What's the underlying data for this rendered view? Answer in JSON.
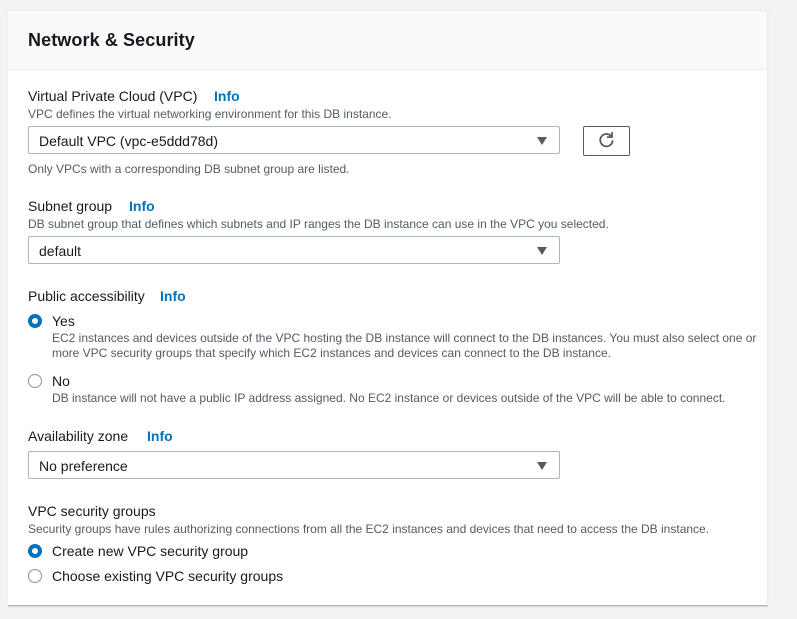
{
  "panel": {
    "title": "Network & Security"
  },
  "vpc": {
    "label": "Virtual Private Cloud (VPC)",
    "info": "Info",
    "description": "VPC defines the virtual networking environment for this DB instance.",
    "selected": "Default VPC (vpc-e5ddd78d)",
    "hint": "Only VPCs with a corresponding DB subnet group are listed.",
    "refresh_icon": "refresh-icon"
  },
  "subnet": {
    "label": "Subnet group",
    "info": "Info",
    "description": "DB subnet group that defines which subnets and IP ranges the DB instance can use in the VPC you selected.",
    "selected": "default"
  },
  "public_access": {
    "label": "Public accessibility",
    "info": "Info",
    "options": [
      {
        "label": "Yes",
        "selected": true,
        "description": "EC2 instances and devices outside of the VPC hosting the DB instance will connect to the DB instances. You must also select one or more VPC security groups that specify which EC2 instances and devices can connect to the DB instance."
      },
      {
        "label": "No",
        "selected": false,
        "description": "DB instance will not have a public IP address assigned. No EC2 instance or devices outside of the VPC will be able to connect."
      }
    ]
  },
  "az": {
    "label": "Availability zone",
    "info": "Info",
    "selected": "No preference"
  },
  "sg": {
    "label": "VPC security groups",
    "description": "Security groups have rules authorizing connections from all the EC2 instances and devices that need to access the DB instance.",
    "options": [
      {
        "label": "Create new VPC security group",
        "selected": true
      },
      {
        "label": "Choose existing VPC security groups",
        "selected": false
      }
    ]
  },
  "colors": {
    "accent": "#0073bb",
    "text": "#16191f",
    "muted": "#545b64",
    "border": "#aab7b8"
  }
}
